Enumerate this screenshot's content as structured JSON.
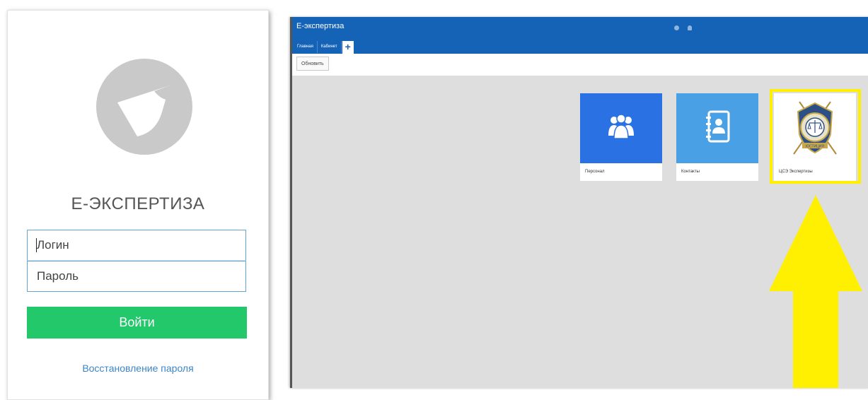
{
  "login": {
    "title": "Е-ЭКСПЕРТИЗА",
    "login_placeholder": "Логин",
    "password_placeholder": "Пароль",
    "submit_label": "Войти",
    "recover_label": "Восстановление пароля"
  },
  "app": {
    "title": "Е-экспертиза",
    "tabs": [
      {
        "label": "Главная"
      },
      {
        "label": "Кабинет"
      }
    ],
    "add_tab_label": "+",
    "toolbar": {
      "refresh_label": "Обновить"
    },
    "tiles": [
      {
        "label": "Персонал",
        "icon": "users-icon",
        "color": "#2a72e4"
      },
      {
        "label": "Контакты",
        "icon": "address-book-icon",
        "color": "#4aa0e5"
      },
      {
        "label": "ЦСЭ Экспертизы",
        "icon": "justice-emblem-icon",
        "highlighted": true
      }
    ],
    "emblem_text": "ЮСТИЦИЯ"
  },
  "colors": {
    "header": "#1563b7",
    "login_button": "#23c86a",
    "link": "#3d85c6",
    "highlight": "#ffef00"
  }
}
